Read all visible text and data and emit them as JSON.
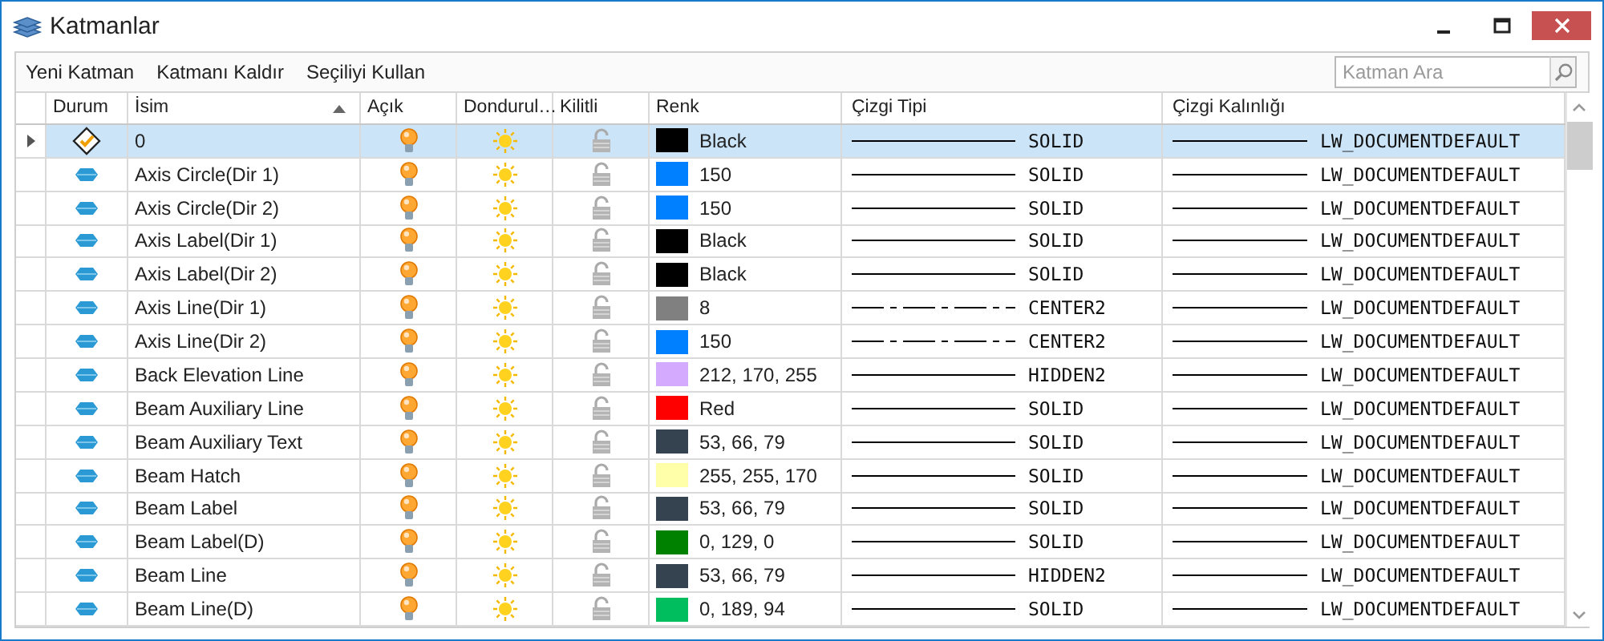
{
  "window": {
    "title": "Katmanlar"
  },
  "toolbar": {
    "items": [
      "Yeni Katman",
      "Katmanı Kaldır",
      "Seçiliyi Kullan"
    ],
    "search": {
      "placeholder": "Katman Ara"
    }
  },
  "table": {
    "columns": [
      {
        "label": "Durum",
        "sorted": false
      },
      {
        "label": "İsim",
        "sorted": true
      },
      {
        "label": "Açık",
        "sorted": false
      },
      {
        "label": "Dondurul…",
        "sorted": false
      },
      {
        "label": "Kilitli",
        "sorted": false
      },
      {
        "label": "Renk",
        "sorted": false
      },
      {
        "label": "Çizgi Tipi",
        "sorted": false
      },
      {
        "label": "Çizgi Kalınlığı",
        "sorted": false
      }
    ],
    "rows": [
      {
        "selected": true,
        "status": {
          "kind": "current"
        },
        "name": "0",
        "on": true,
        "frozen": false,
        "locked": false,
        "color": "#000000",
        "color_label": "Black",
        "linetype": {
          "kind": "solid",
          "label": "SOLID"
        },
        "lineweight": "LW_DOCUMENTDEFAULT"
      },
      {
        "selected": false,
        "status": {
          "kind": "layer"
        },
        "name": "Axis Circle(Dir 1)",
        "on": true,
        "frozen": false,
        "locked": false,
        "color": "#0080ff",
        "color_label": "150",
        "linetype": {
          "kind": "solid",
          "label": "SOLID"
        },
        "lineweight": "LW_DOCUMENTDEFAULT"
      },
      {
        "selected": false,
        "status": {
          "kind": "layer"
        },
        "name": "Axis Circle(Dir 2)",
        "on": true,
        "frozen": false,
        "locked": false,
        "color": "#0080ff",
        "color_label": "150",
        "linetype": {
          "kind": "solid",
          "label": "SOLID"
        },
        "lineweight": "LW_DOCUMENTDEFAULT"
      },
      {
        "selected": false,
        "status": {
          "kind": "layer"
        },
        "name": "Axis Label(Dir 1)",
        "on": true,
        "frozen": false,
        "locked": false,
        "color": "#000000",
        "color_label": "Black",
        "linetype": {
          "kind": "solid",
          "label": "SOLID"
        },
        "lineweight": "LW_DOCUMENTDEFAULT"
      },
      {
        "selected": false,
        "status": {
          "kind": "layer"
        },
        "name": "Axis Label(Dir 2)",
        "on": true,
        "frozen": false,
        "locked": false,
        "color": "#000000",
        "color_label": "Black",
        "linetype": {
          "kind": "solid",
          "label": "SOLID"
        },
        "lineweight": "LW_DOCUMENTDEFAULT"
      },
      {
        "selected": false,
        "status": {
          "kind": "layer"
        },
        "name": "Axis Line(Dir 1)",
        "on": true,
        "frozen": false,
        "locked": false,
        "color": "#808080",
        "color_label": "8",
        "linetype": {
          "kind": "center",
          "label": "CENTER2"
        },
        "lineweight": "LW_DOCUMENTDEFAULT"
      },
      {
        "selected": false,
        "status": {
          "kind": "layer"
        },
        "name": "Axis Line(Dir 2)",
        "on": true,
        "frozen": false,
        "locked": false,
        "color": "#0080ff",
        "color_label": "150",
        "linetype": {
          "kind": "center",
          "label": "CENTER2"
        },
        "lineweight": "LW_DOCUMENTDEFAULT"
      },
      {
        "selected": false,
        "status": {
          "kind": "layer"
        },
        "name": "Back Elevation Line",
        "on": true,
        "frozen": false,
        "locked": false,
        "color": "#d4aaff",
        "color_label": "212, 170, 255",
        "linetype": {
          "kind": "solid",
          "label": "HIDDEN2"
        },
        "lineweight": "LW_DOCUMENTDEFAULT"
      },
      {
        "selected": false,
        "status": {
          "kind": "layer"
        },
        "name": "Beam Auxiliary Line",
        "on": true,
        "frozen": false,
        "locked": false,
        "color": "#ff0000",
        "color_label": "Red",
        "linetype": {
          "kind": "solid",
          "label": "SOLID"
        },
        "lineweight": "LW_DOCUMENTDEFAULT"
      },
      {
        "selected": false,
        "status": {
          "kind": "layer"
        },
        "name": "Beam Auxiliary Text",
        "on": true,
        "frozen": false,
        "locked": false,
        "color": "#35424f",
        "color_label": "53, 66, 79",
        "linetype": {
          "kind": "solid",
          "label": "SOLID"
        },
        "lineweight": "LW_DOCUMENTDEFAULT"
      },
      {
        "selected": false,
        "status": {
          "kind": "layer"
        },
        "name": "Beam Hatch",
        "on": true,
        "frozen": false,
        "locked": false,
        "color": "#ffffaa",
        "color_label": "255, 255, 170",
        "linetype": {
          "kind": "solid",
          "label": "SOLID"
        },
        "lineweight": "LW_DOCUMENTDEFAULT"
      },
      {
        "selected": false,
        "status": {
          "kind": "layer"
        },
        "name": "Beam Label",
        "on": true,
        "frozen": false,
        "locked": false,
        "color": "#35424f",
        "color_label": "53, 66, 79",
        "linetype": {
          "kind": "solid",
          "label": "SOLID"
        },
        "lineweight": "LW_DOCUMENTDEFAULT"
      },
      {
        "selected": false,
        "status": {
          "kind": "layer"
        },
        "name": "Beam Label(D)",
        "on": true,
        "frozen": false,
        "locked": false,
        "color": "#008100",
        "color_label": "0, 129, 0",
        "linetype": {
          "kind": "solid",
          "label": "SOLID"
        },
        "lineweight": "LW_DOCUMENTDEFAULT"
      },
      {
        "selected": false,
        "status": {
          "kind": "layer"
        },
        "name": "Beam Line",
        "on": true,
        "frozen": false,
        "locked": false,
        "color": "#35424f",
        "color_label": "53, 66, 79",
        "linetype": {
          "kind": "solid",
          "label": "HIDDEN2"
        },
        "lineweight": "LW_DOCUMENTDEFAULT"
      },
      {
        "selected": false,
        "status": {
          "kind": "layer"
        },
        "name": "Beam Line(D)",
        "on": true,
        "frozen": false,
        "locked": false,
        "color": "#00bd5e",
        "color_label": "0, 189, 94",
        "linetype": {
          "kind": "solid",
          "label": "SOLID"
        },
        "lineweight": "LW_DOCUMENTDEFAULT"
      }
    ]
  }
}
